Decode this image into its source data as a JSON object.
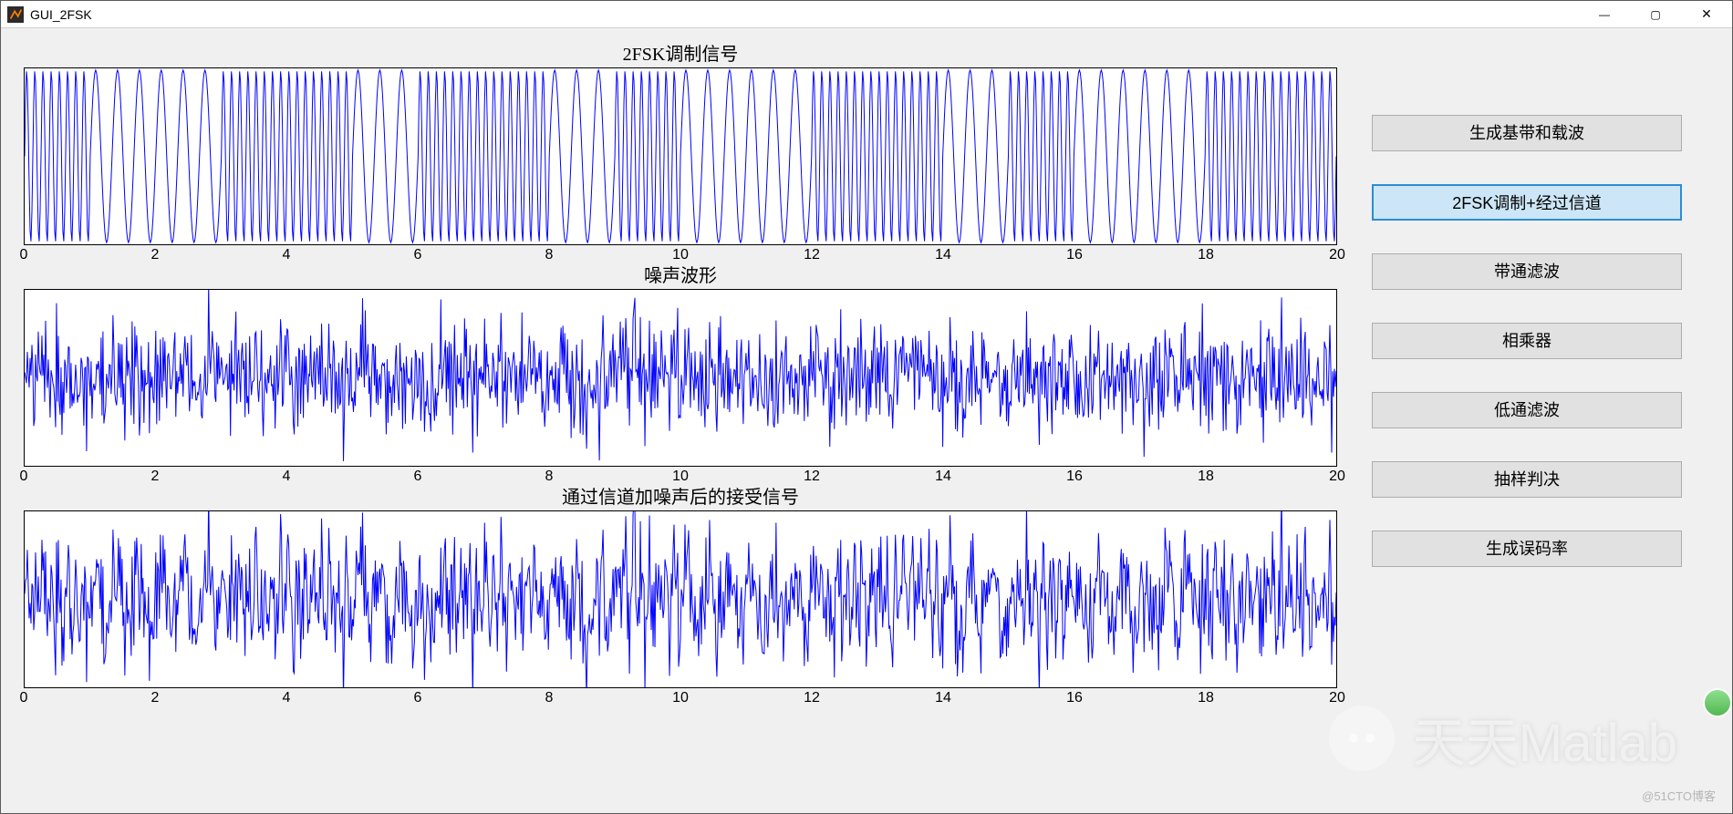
{
  "window": {
    "title": "GUI_2FSK"
  },
  "window_controls": {
    "min": "—",
    "max": "▢",
    "close": "✕"
  },
  "plots": [
    {
      "title": "2FSK调制信号",
      "xticks": [
        "0",
        "2",
        "4",
        "6",
        "8",
        "10",
        "12",
        "14",
        "16",
        "18",
        "20"
      ],
      "xlim": [
        0,
        20
      ],
      "ylim": [
        -1,
        1
      ]
    },
    {
      "title": "噪声波形",
      "xticks": [
        "0",
        "2",
        "4",
        "6",
        "8",
        "10",
        "12",
        "14",
        "16",
        "18",
        "20"
      ],
      "xlim": [
        0,
        20
      ],
      "ylim": [
        -3,
        3
      ]
    },
    {
      "title": "通过信道加噪声后的接受信号",
      "xticks": [
        "0",
        "2",
        "4",
        "6",
        "8",
        "10",
        "12",
        "14",
        "16",
        "18",
        "20"
      ],
      "xlim": [
        0,
        20
      ],
      "ylim": [
        -3,
        3
      ]
    }
  ],
  "fsk_bits": [
    1,
    0,
    0,
    1,
    1,
    0,
    1,
    1,
    0,
    1,
    0,
    0,
    1,
    1,
    0,
    1,
    0,
    0,
    1,
    1
  ],
  "fsk_freq": {
    "f0": 3,
    "f1": 8
  },
  "buttons": [
    {
      "id": "gen-baseband",
      "label": "生成基带和载波",
      "selected": false
    },
    {
      "id": "fsk-channel",
      "label": "2FSK调制+经过信道",
      "selected": true
    },
    {
      "id": "bandpass",
      "label": "带通滤波",
      "selected": false
    },
    {
      "id": "multiplier",
      "label": "相乘器",
      "selected": false
    },
    {
      "id": "lowpass",
      "label": "低通滤波",
      "selected": false
    },
    {
      "id": "sample-decide",
      "label": "抽样判决",
      "selected": false
    },
    {
      "id": "ber",
      "label": "生成误码率",
      "selected": false
    }
  ],
  "watermark": {
    "text": "天天Matlab",
    "footer": "@51CTO博客"
  },
  "colors": {
    "signal": "#0000ff",
    "panel": "#f0f0f0",
    "btn_sel_bg": "#cde6f7",
    "btn_sel_border": "#2a8dd4"
  },
  "chart_data": [
    {
      "type": "line",
      "title": "2FSK调制信号",
      "xlim": [
        0,
        20
      ],
      "ylim": [
        -1,
        1
      ],
      "description": "20位二进制数据的2FSK调制,bit=1时载波频率高(约8周期/bit),bit=0时载波频率低(约3周期/bit)",
      "bits": [
        1,
        0,
        0,
        1,
        1,
        0,
        1,
        1,
        0,
        1,
        0,
        0,
        1,
        1,
        0,
        1,
        0,
        0,
        1,
        1
      ]
    },
    {
      "type": "line",
      "title": "噪声波形",
      "xlim": [
        0,
        20
      ],
      "ylim": [
        -3,
        3
      ],
      "description": "加性高斯白噪声,幅度大致在±2~±3之间随机波动"
    },
    {
      "type": "line",
      "title": "通过信道加噪声后的接受信号",
      "xlim": [
        0,
        20
      ],
      "ylim": [
        -3,
        3
      ],
      "description": "2FSK调制信号与噪声波形之和"
    }
  ]
}
